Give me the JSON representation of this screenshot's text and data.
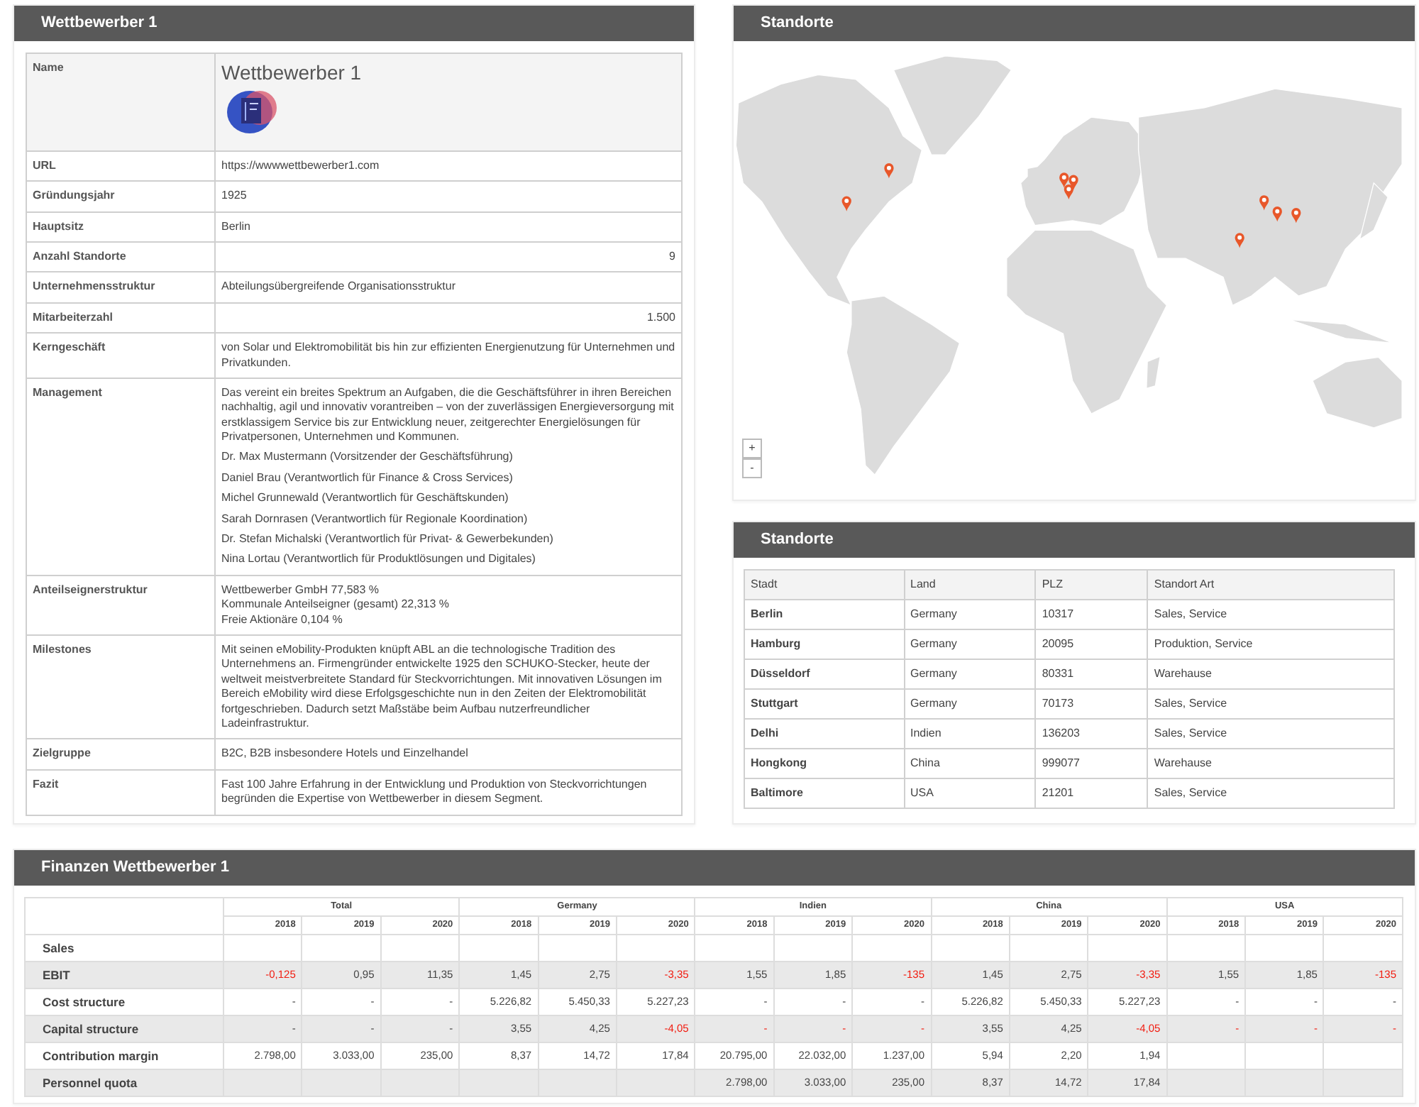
{
  "profile": {
    "title": "Wettbewerber 1",
    "name_label": "Name",
    "name": "Wettbewerber 1",
    "rows": [
      {
        "kind": "text",
        "label": "URL",
        "value": "https://wwwwettbewerber1.com"
      },
      {
        "kind": "text",
        "label": "Gründungsjahr",
        "value": "1925"
      },
      {
        "kind": "text",
        "label": "Hauptsitz",
        "value": "Berlin"
      },
      {
        "kind": "number",
        "label": "Anzahl Standorte",
        "value": "9"
      },
      {
        "kind": "text",
        "label": "Unternehmensstruktur",
        "value": "Abteilungsübergreifende Organisationsstruktur"
      },
      {
        "kind": "number",
        "label": "Mitarbeiterzahl",
        "value": "1.500"
      },
      {
        "kind": "text",
        "label": "Kerngeschäft",
        "value": "von Solar und Elektromobilität bis hin zur effizienten Energienutzung für Unternehmen und Privatkunden."
      },
      {
        "kind": "management",
        "label": "Management",
        "value": "Das vereint ein breites Spektrum an Aufgaben, die die Geschäftsführer in ihren Bereichen nachhaltig, agil und innovativ vorantreiben – von der zuverlässigen Energieversorgung mit erstklassigem Service bis zur Entwicklung neuer, zeitgerechter Energielösungen für Privatpersonen, Unternehmen und Kommunen.",
        "people": [
          "Dr. Max Mustermann (Vorsitzender der Geschäftsführung)",
          "Daniel Brau (Verantwortlich für Finance & Cross Services)",
          "Michel Grunnewald (Verantwortlich für Geschäftskunden)",
          "Sarah Dornrasen (Verantwortlich für Regionale Koordination)",
          "Dr. Stefan Michalski (Verantwortlich für Privat- & Gewerbekunden)",
          "Nina Lortau (Verantwortlich für Produktlösungen und Digitales)"
        ]
      },
      {
        "kind": "lines",
        "label": "Anteilseignerstruktur",
        "lines": [
          "Wettbewerber GmbH 77,583 %",
          "Kommunale Anteilseigner (gesamt) 22,313 %",
          "Freie Aktionäre 0,104 %"
        ]
      },
      {
        "kind": "text",
        "label": "Milestones",
        "value": "Mit seinen eMobility-Produkten knüpft ABL an die technologische Tradition des Unternehmens an. Firmengründer entwickelte 1925 den SCHUKO-Stecker, heute der weltweit meistverbreitete Standard für Steckvorrichtungen. Mit innovativen Lösungen im Bereich eMobility wird diese Erfolgsgeschichte nun in den Zeiten der Elektromobilität fortgeschrieben. Dadurch setzt Maßstäbe beim Aufbau nutzerfreundlicher Ladeinfrastruktur."
      },
      {
        "kind": "text",
        "label": "Zielgruppe",
        "value": "B2C, B2B insbesondere Hotels und Einzelhandel"
      },
      {
        "kind": "text",
        "label": "Fazit",
        "value": "Fast 100 Jahre Erfahrung in der Entwicklung und Produktion von Steckvorrichtungen begründen die Expertise von Wettbewerber in diesem Segment."
      }
    ]
  },
  "map": {
    "title": "Standorte",
    "zoom_controls": [
      "+",
      "-"
    ]
  },
  "locations": {
    "title": "Standorte",
    "columns": [
      "Stadt",
      "Land",
      "PLZ",
      "Standort Art"
    ],
    "rows": [
      [
        "Berlin",
        "Germany",
        "10317",
        "Sales, Service"
      ],
      [
        "Hamburg",
        "Germany",
        "20095",
        "Produktion, Service"
      ],
      [
        "Düsseldorf",
        "Germany",
        "80331",
        "Warehause"
      ],
      [
        "Stuttgart",
        "Germany",
        "70173",
        "Sales, Service"
      ],
      [
        "Delhi",
        "Indien",
        "136203",
        "Sales, Service"
      ],
      [
        "Hongkong",
        "China",
        "999077",
        "Warehause"
      ],
      [
        "Baltimore",
        "USA",
        "21201",
        "Sales, Service"
      ]
    ]
  },
  "finance": {
    "title": "Finanzen Wettbewerber 1",
    "groups": [
      {
        "name": "Total",
        "years": [
          "2018",
          "2019",
          "2020"
        ]
      },
      {
        "name": "Germany",
        "years": [
          "2018",
          "2019",
          "2020"
        ]
      },
      {
        "name": "Indien",
        "years": [
          "2018",
          "2019",
          "2020"
        ]
      },
      {
        "name": "China",
        "years": [
          "2018",
          "2019",
          "2020"
        ]
      },
      {
        "name": "USA",
        "years": [
          "2018",
          "2019",
          "2020"
        ]
      }
    ],
    "rows": [
      {
        "label": "Sales",
        "cells": [
          null,
          null,
          null,
          null,
          null,
          null,
          null,
          null,
          null,
          null,
          null,
          null,
          null,
          null,
          null
        ]
      },
      {
        "label": "EBIT",
        "cells": [
          {
            "text": "-0,125",
            "alert": true
          },
          {
            "text": "0,95",
            "alert": false
          },
          {
            "text": "11,35",
            "alert": false
          },
          {
            "text": "1,45",
            "alert": false
          },
          {
            "text": "2,75",
            "alert": false
          },
          {
            "text": "-3,35",
            "alert": true
          },
          {
            "text": "1,55",
            "alert": false
          },
          {
            "text": "1,85",
            "alert": false
          },
          {
            "text": "-135",
            "alert": true
          },
          {
            "text": "1,45",
            "alert": false
          },
          {
            "text": "2,75",
            "alert": false
          },
          {
            "text": "-3,35",
            "alert": true
          },
          {
            "text": "1,55",
            "alert": false
          },
          {
            "text": "1,85",
            "alert": false
          },
          {
            "text": "-135",
            "alert": true
          }
        ]
      },
      {
        "label": "Cost structure",
        "cells": [
          {
            "text": "-",
            "alert": false
          },
          {
            "text": "-",
            "alert": false
          },
          {
            "text": "-",
            "alert": false
          },
          {
            "text": "5.226,82",
            "alert": false
          },
          {
            "text": "5.450,33",
            "alert": false
          },
          {
            "text": "5.227,23",
            "alert": false
          },
          {
            "text": "-",
            "alert": false
          },
          {
            "text": "-",
            "alert": false
          },
          {
            "text": "-",
            "alert": false
          },
          {
            "text": "5.226,82",
            "alert": false
          },
          {
            "text": "5.450,33",
            "alert": false
          },
          {
            "text": "5.227,23",
            "alert": false
          },
          {
            "text": "-",
            "alert": false
          },
          {
            "text": "-",
            "alert": false
          },
          {
            "text": "-",
            "alert": false
          }
        ]
      },
      {
        "label": "Capital structure",
        "cells": [
          {
            "text": "-",
            "alert": false
          },
          {
            "text": "-",
            "alert": false
          },
          {
            "text": "-",
            "alert": false
          },
          {
            "text": "3,55",
            "alert": false
          },
          {
            "text": "4,25",
            "alert": false
          },
          {
            "text": "-4,05",
            "alert": true
          },
          {
            "text": "-",
            "alert": true
          },
          {
            "text": "-",
            "alert": true
          },
          {
            "text": "-",
            "alert": true
          },
          {
            "text": "3,55",
            "alert": false
          },
          {
            "text": "4,25",
            "alert": false
          },
          {
            "text": "-4,05",
            "alert": true
          },
          {
            "text": "-",
            "alert": true
          },
          {
            "text": "-",
            "alert": true
          },
          {
            "text": "-",
            "alert": true
          }
        ]
      },
      {
        "label": "Contribution margin",
        "cells": [
          {
            "text": "2.798,00",
            "alert": false
          },
          {
            "text": "3.033,00",
            "alert": false
          },
          {
            "text": "235,00",
            "alert": false
          },
          {
            "text": "8,37",
            "alert": false
          },
          {
            "text": "14,72",
            "alert": false
          },
          {
            "text": "17,84",
            "alert": false
          },
          {
            "text": "20.795,00",
            "alert": false
          },
          {
            "text": "22.032,00",
            "alert": false
          },
          {
            "text": "1.237,00",
            "alert": false
          },
          {
            "text": "5,94",
            "alert": false
          },
          {
            "text": "2,20",
            "alert": false
          },
          {
            "text": "1,94",
            "alert": false
          },
          null,
          null,
          null
        ]
      },
      {
        "label": "Personnel quota",
        "cells": [
          null,
          null,
          null,
          null,
          null,
          null,
          {
            "text": "2.798,00",
            "alert": false
          },
          {
            "text": "3.033,00",
            "alert": false
          },
          {
            "text": "235,00",
            "alert": false
          },
          {
            "text": "8,37",
            "alert": false
          },
          {
            "text": "14,72",
            "alert": false
          },
          {
            "text": "17,84",
            "alert": false
          },
          null,
          null,
          null
        ]
      }
    ]
  }
}
